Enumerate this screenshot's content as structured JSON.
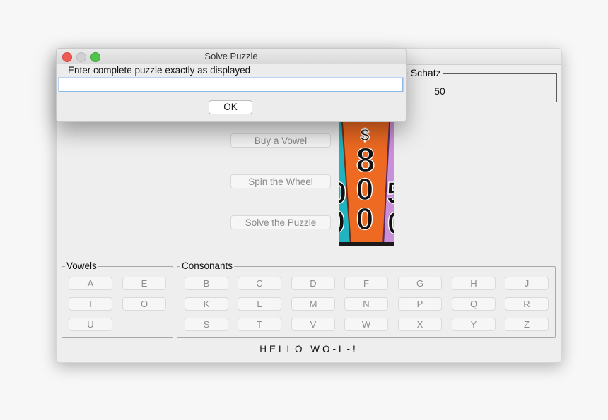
{
  "dialog": {
    "title": "Solve Puzzle",
    "prompt": "Enter complete puzzle exactly as displayed",
    "input_value": "",
    "ok_label": "OK"
  },
  "player": {
    "name_label": "le Schatz",
    "score": "50"
  },
  "actions": {
    "buy_vowel": "Buy a Vowel",
    "spin_wheel": "Spin the Wheel",
    "solve_puzzle": "Solve the Puzzle"
  },
  "wheel": {
    "segment_amount": "$800"
  },
  "vowels": {
    "legend": "Vowels",
    "letters": [
      "A",
      "E",
      "I",
      "O",
      "U"
    ]
  },
  "consonants": {
    "legend": "Consonants",
    "letters": [
      "B",
      "C",
      "D",
      "F",
      "G",
      "H",
      "J",
      "K",
      "L",
      "M",
      "N",
      "P",
      "Q",
      "R",
      "S",
      "T",
      "V",
      "W",
      "X",
      "Y",
      "Z"
    ]
  },
  "puzzle": {
    "display": "HELLO WO-L-!"
  },
  "colors": {
    "close": "#ee5b55",
    "minimize": "#d0d0d0",
    "maximize": "#4fc44a",
    "wheel_teal": "#21b3bf",
    "wheel_orange": "#ee6a22",
    "wheel_purple": "#c98fd8"
  }
}
